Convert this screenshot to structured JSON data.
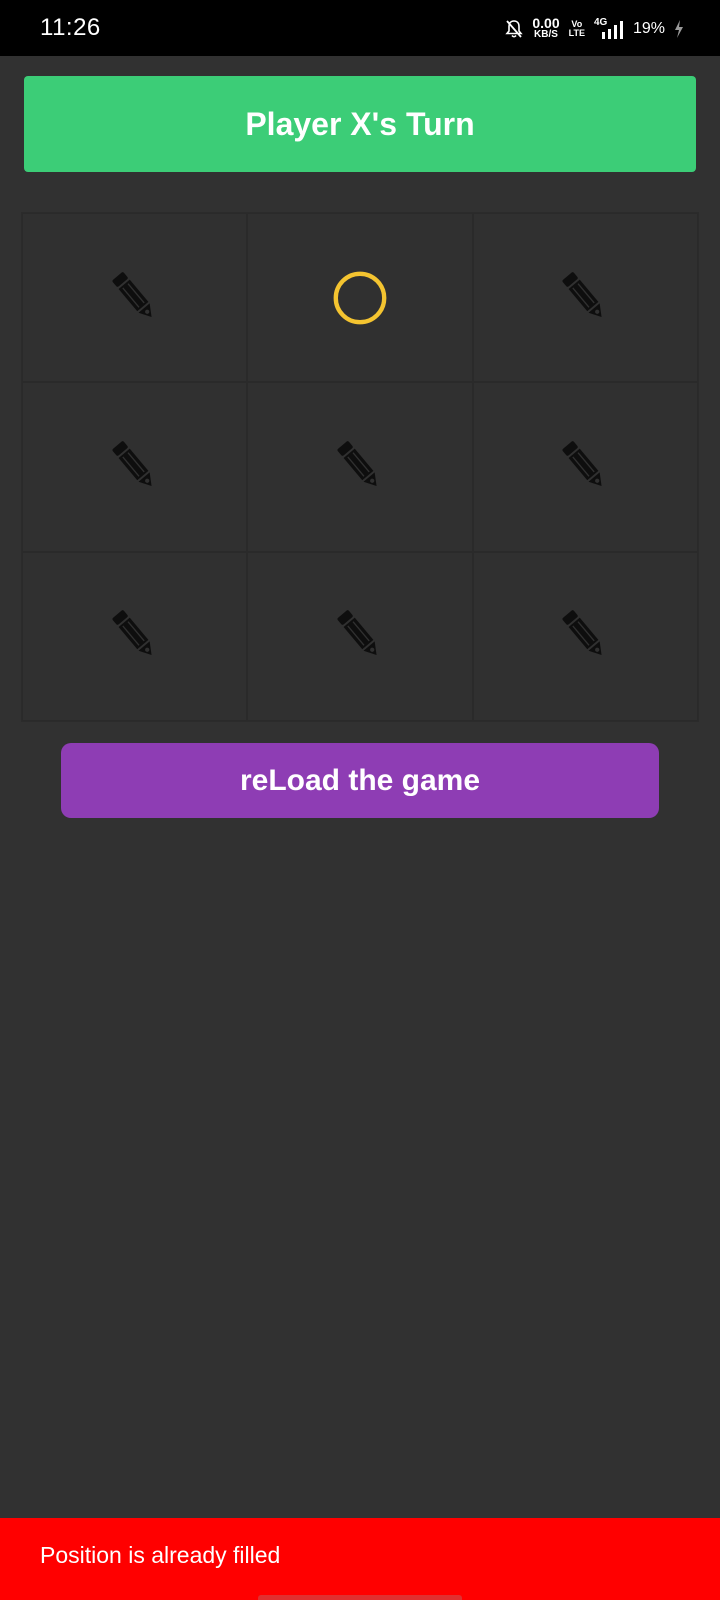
{
  "status_bar": {
    "time": "11:26",
    "net_speed_value": "0.00",
    "net_speed_unit": "KB/S",
    "volte_top": "Vo",
    "volte_bottom": "LTE",
    "network_type": "4G",
    "battery_percent": "19%",
    "icons": [
      "bell-off-icon",
      "signal-icon",
      "charging-icon"
    ]
  },
  "header": {
    "turn_text": "Player X's Turn",
    "color": "#3ccd77"
  },
  "board": {
    "cells": [
      "pencil",
      "o",
      "pencil",
      "pencil",
      "pencil",
      "pencil",
      "pencil",
      "pencil",
      "pencil"
    ],
    "o_color": "#f4c430"
  },
  "actions": {
    "reload_label": "reLoad the game",
    "color": "#8e3db4"
  },
  "snackbar": {
    "message": "Position is already filled",
    "color": "#ff0000"
  }
}
